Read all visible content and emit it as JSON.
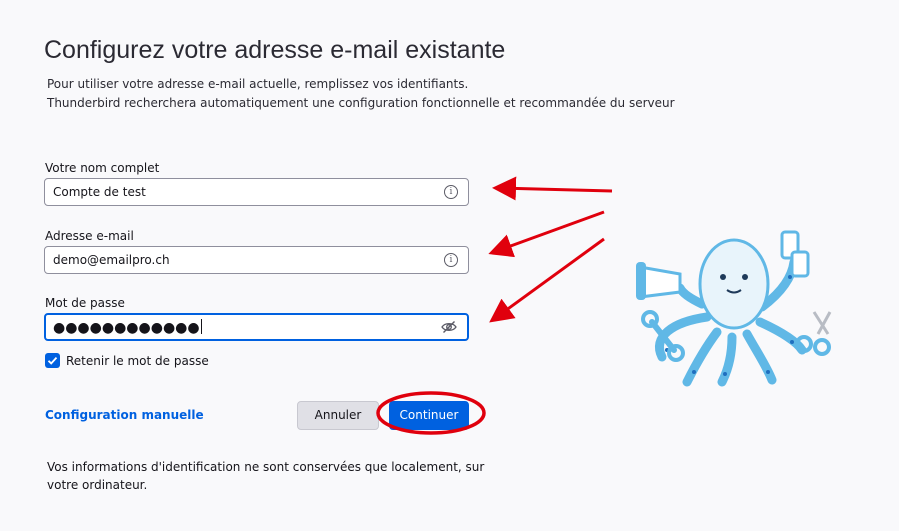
{
  "page": {
    "title": "Configurez votre adresse e-mail existante",
    "intro_line1": "Pour utiliser votre adresse e-mail actuelle, remplissez vos identifiants.",
    "intro_line2": "Thunderbird recherchera automatiquement une configuration fonctionnelle et recommandée du serveur"
  },
  "form": {
    "name_label": "Votre nom complet",
    "name_value": "Compte de test",
    "email_label": "Adresse e-mail",
    "email_value": "demo@emailpro.ch",
    "password_label": "Mot de passe",
    "password_value": "●●●●●●●●●●●●",
    "remember_label": "Retenir le mot de passe",
    "remember_checked": true
  },
  "actions": {
    "manual_config": "Configuration manuelle",
    "cancel": "Annuler",
    "continue": "Continuer"
  },
  "footer": {
    "note": "Vos informations d'identification ne sont conservées que localement, sur votre ordinateur."
  },
  "icons": {
    "info": "info-icon",
    "eye": "eye-slash-icon",
    "check": "checkmark-icon"
  },
  "colors": {
    "accent": "#0061e0",
    "annotation": "#e0000d",
    "mascot": "#60b8e6"
  }
}
